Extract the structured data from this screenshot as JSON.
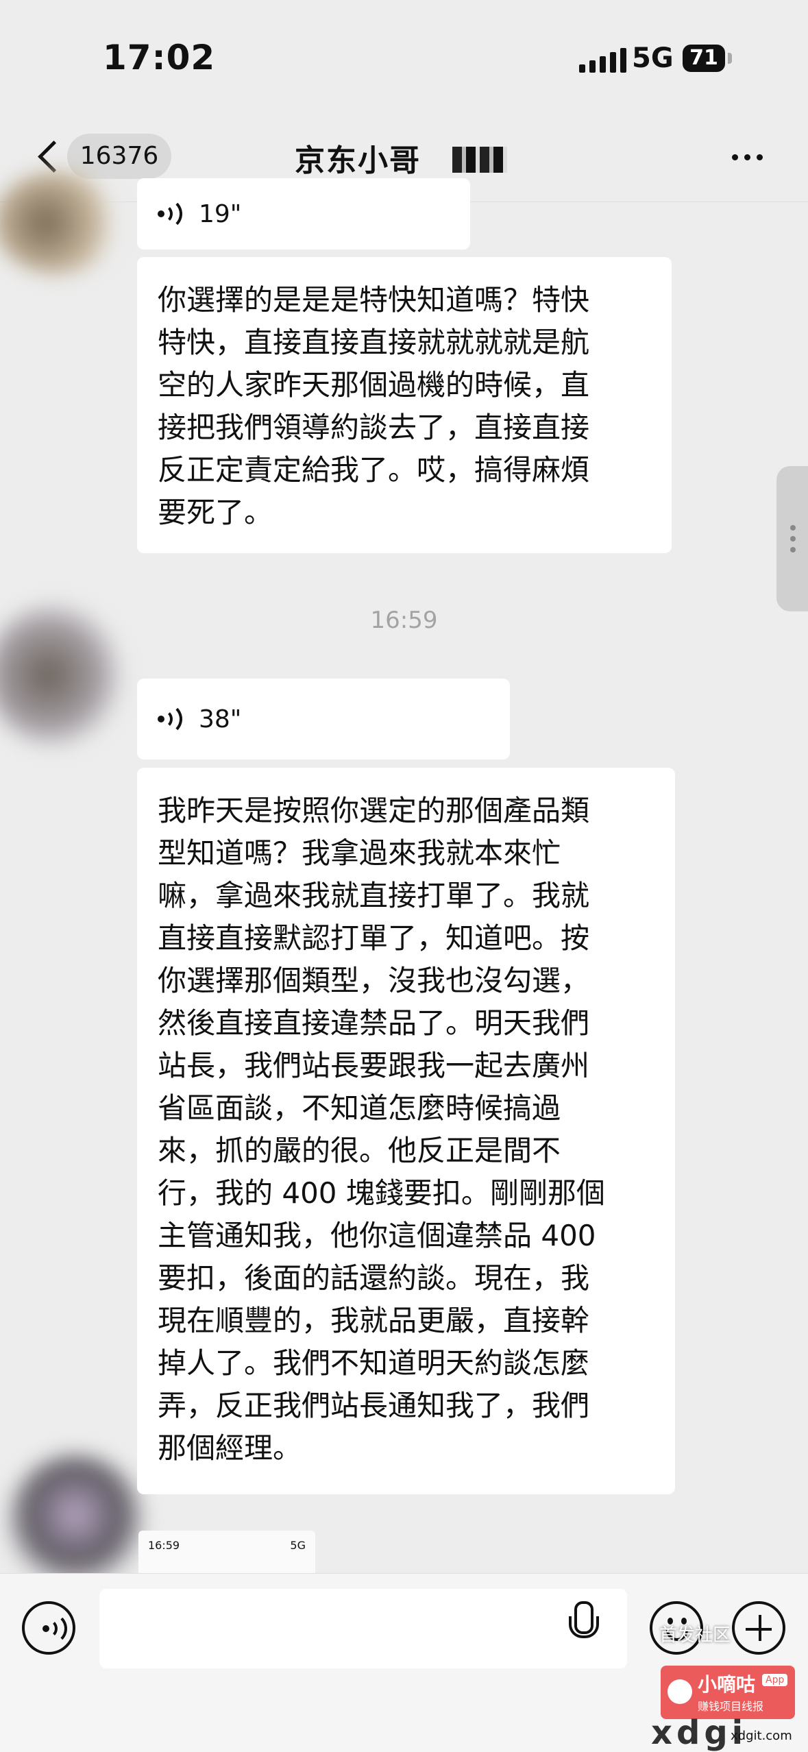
{
  "status_bar": {
    "time": "17:02",
    "network": "5G",
    "battery": "71"
  },
  "header": {
    "unread_count": "16376",
    "title": "京东小哥"
  },
  "messages": [
    {
      "type": "voice",
      "duration": "19\""
    },
    {
      "type": "text",
      "text": "你選擇的是是是特快知道嗎？特快\n特快，直接直接直接就就就就是航\n空的人家昨天那個過機的時候，直\n接把我們領導約談去了，直接直接\n反正定責定給我了。哎，搞得麻煩\n要死了。"
    },
    {
      "type": "timestamp",
      "text": "16:59"
    },
    {
      "type": "voice",
      "duration": "38\""
    },
    {
      "type": "text",
      "text": "我昨天是按照你選定的那個產品類\n型知道嗎？我拿過來我就本來忙\n嘛，拿過來我就直接打單了。我就\n直接直接默認打單了，知道吧。按\n你選擇那個類型，沒我也沒勾選，\n然後直接直接違禁品了。明天我們\n站長，我們站長要跟我一起去廣州\n省區面談，不知道怎麼時候搞過\n來，抓的嚴的很。他反正是間不\n行，我的 400 塊錢要扣。剛剛那個\n主管通知我，他你這個違禁品 400\n要扣，後面的話還約談。現在，我\n現在順豐的，我就品更嚴，直接幹\n掉人了。我們不知道明天約談怎麼\n弄，反正我們站長通知我了，我們\n那個經理。"
    },
    {
      "type": "image",
      "thumb_time": "16:59",
      "thumb_network": "5G"
    }
  ],
  "watermark": {
    "overlay_text": "首发社区",
    "brand": "小嘀咕",
    "tag": "App",
    "subtitle": "赚钱项目线报",
    "site": "xdgi",
    "url": "xdgit.com"
  },
  "icons": [
    "back-icon",
    "more-icon",
    "voice-wave-icon",
    "voice-mode-icon",
    "mic-icon",
    "emoji-icon",
    "plus-icon"
  ]
}
